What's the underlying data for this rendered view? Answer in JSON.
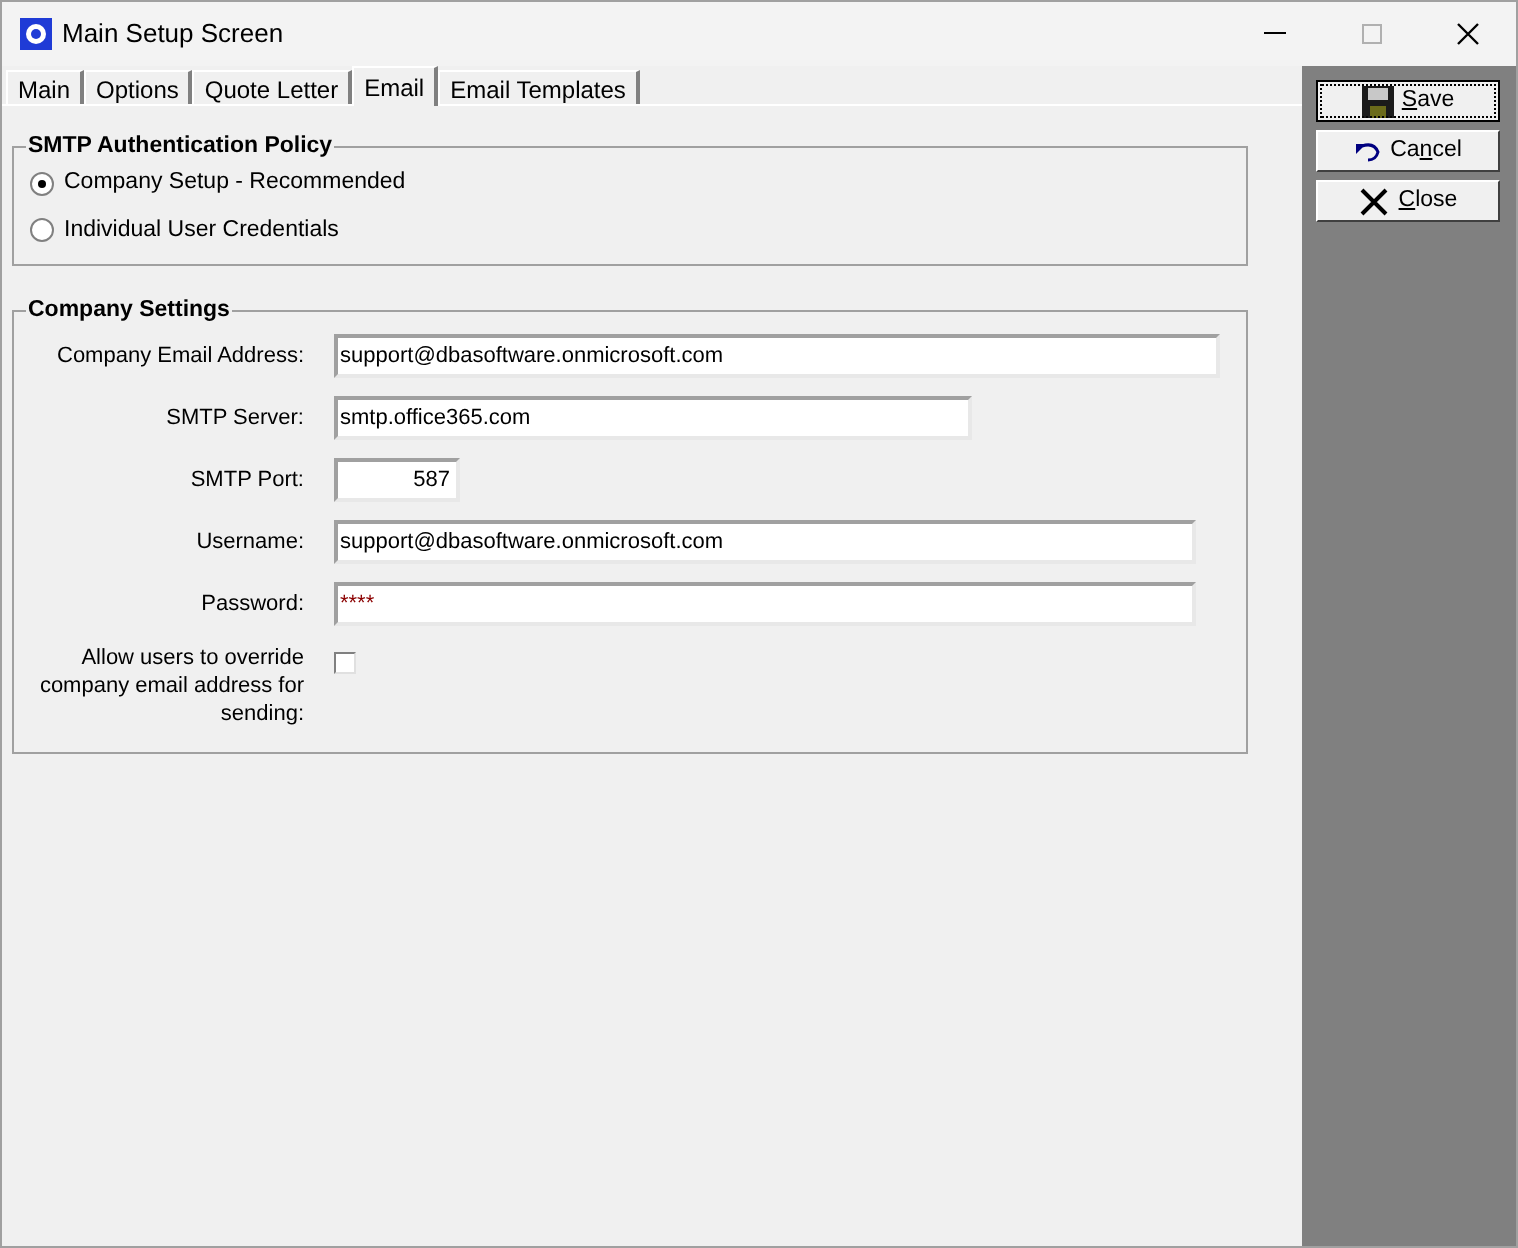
{
  "window": {
    "title": "Main Setup Screen"
  },
  "tabs": [
    {
      "label": "Main",
      "selected": false
    },
    {
      "label": "Options",
      "selected": false
    },
    {
      "label": "Quote Letter",
      "selected": false
    },
    {
      "label": "Email",
      "selected": true
    },
    {
      "label": "Email Templates",
      "selected": false
    }
  ],
  "auth_policy": {
    "title": "SMTP Authentication Policy",
    "options": [
      {
        "label": "Company Setup - Recommended",
        "selected": true
      },
      {
        "label": "Individual User Credentials",
        "selected": false
      }
    ]
  },
  "company_settings": {
    "title": "Company Settings",
    "fields": [
      {
        "kind": "text",
        "label": "Company Email Address:",
        "value": "support@dbasoftware.onmicrosoft.com"
      },
      {
        "kind": "text",
        "label": "SMTP Server:",
        "value": "smtp.office365.com"
      },
      {
        "kind": "number",
        "label": "SMTP Port:",
        "value": "587"
      },
      {
        "kind": "text",
        "label": "Username:",
        "value": "support@dbasoftware.onmicrosoft.com"
      },
      {
        "kind": "password",
        "label": "Password:",
        "value": "****"
      },
      {
        "kind": "checkbox",
        "label": "Allow users to override company email address for sending:",
        "checked": false
      }
    ]
  },
  "buttons": [
    {
      "kind": "save",
      "key": "S",
      "after": "ave",
      "focused": true
    },
    {
      "kind": "cancel",
      "before": "Ca",
      "key": "n",
      "after": "cel",
      "focused": false
    },
    {
      "kind": "close",
      "key": "C",
      "after": "lose",
      "focused": false
    }
  ]
}
